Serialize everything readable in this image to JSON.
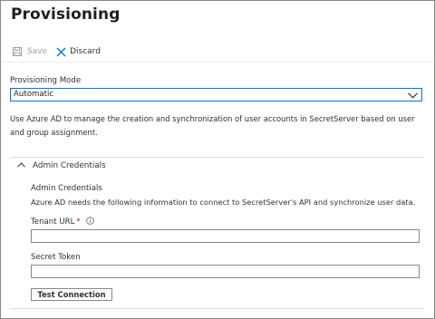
{
  "page": {
    "title": "Provisioning",
    "more_label": "···"
  },
  "toolbar": {
    "save_label": "Save",
    "discard_label": "Discard"
  },
  "provisioning_mode": {
    "label": "Provisioning Mode",
    "selected": "Automatic"
  },
  "description": "Use Azure AD to manage the creation and synchronization of user accounts in SecretServer based on user and group assignment.",
  "admin_credentials": {
    "section_title": "Admin Credentials",
    "subtitle": "Admin Credentials",
    "subdescription": "Azure AD needs the following information to connect to SecretServer's API and synchronize user data.",
    "tenant_url": {
      "label": "Tenant URL",
      "required_mark": "*",
      "value": ""
    },
    "secret_token": {
      "label": "Secret Token",
      "value": ""
    },
    "test_button_label": "Test Connection"
  }
}
